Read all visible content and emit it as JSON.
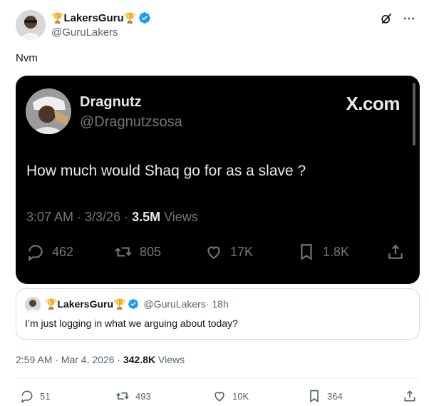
{
  "author": {
    "display_name": "LakersGuru",
    "trophy_emoji": "🏆",
    "handle": "@GuruLakers",
    "verified": true
  },
  "tweet": {
    "text": "Nvm",
    "timestamp": "2:59 AM · Mar 4, 2026 · ",
    "views_count": "342.8K",
    "views_label": " Views"
  },
  "header_icons": [
    "grok-icon",
    "more-icon"
  ],
  "embedded_screenshot": {
    "name": "Dragnutz",
    "handle": "@Dragnutzsosa",
    "brand": "X.com",
    "text": "How much would Shaq go for as a slave ?",
    "timestamp": "3:07 AM · 3/3/26 · ",
    "views_count": "3.5M",
    "views_label": " Views",
    "replies": "462",
    "reposts": "805",
    "likes": "17K",
    "bookmarks": "1.8K"
  },
  "quote": {
    "display_name": "LakersGuru",
    "trophy_emoji": "🏆",
    "handle": "@GuruLakers",
    "time": " · 18h",
    "text": "I’m just logging in what we arguing about today?"
  },
  "actions": {
    "replies": "51",
    "reposts": "493",
    "likes": "10K",
    "bookmarks": "364"
  },
  "colors": {
    "verified_blue": "#1d9bf0",
    "text_primary": "#0f1419",
    "text_secondary": "#536471",
    "media_bg": "#000000"
  }
}
